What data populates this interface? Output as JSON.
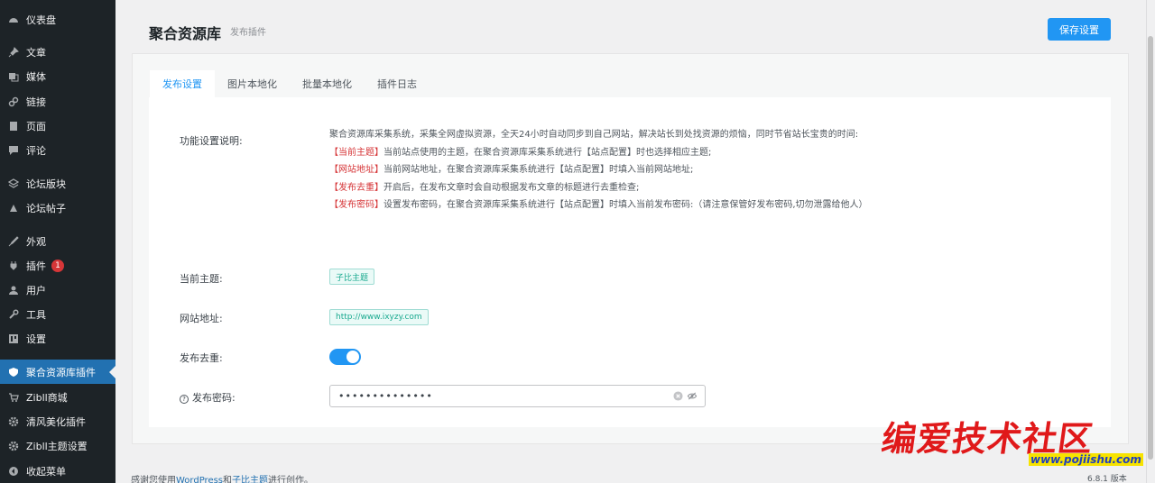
{
  "sidebar": {
    "items": [
      {
        "label": "仪表盘",
        "icon": "dashboard-icon"
      },
      {
        "label": "文章",
        "icon": "pin-icon"
      },
      {
        "label": "媒体",
        "icon": "media-icon"
      },
      {
        "label": "链接",
        "icon": "link-icon"
      },
      {
        "label": "页面",
        "icon": "page-icon"
      },
      {
        "label": "评论",
        "icon": "comment-icon"
      },
      {
        "label": "论坛版块",
        "icon": "forum-icon"
      },
      {
        "label": "论坛帖子",
        "icon": "forum-post-icon"
      },
      {
        "label": "外观",
        "icon": "appearance-icon"
      },
      {
        "label": "插件",
        "icon": "plugin-icon",
        "badge": "1"
      },
      {
        "label": "用户",
        "icon": "user-icon"
      },
      {
        "label": "工具",
        "icon": "wrench-icon"
      },
      {
        "label": "设置",
        "icon": "settings-icon"
      },
      {
        "label": "聚合资源库插件",
        "icon": "shield-icon",
        "active": true
      },
      {
        "label": "Zibll商城",
        "icon": "cart-icon"
      },
      {
        "label": "清风美化插件",
        "icon": "gear-icon"
      },
      {
        "label": "Zibll主题设置",
        "icon": "gear-icon"
      },
      {
        "label": "收起菜单",
        "icon": "collapse-icon"
      }
    ]
  },
  "header": {
    "title": "聚合资源库",
    "subtitle": "发布插件",
    "save_label": "保存设置"
  },
  "tabs": [
    {
      "label": "发布设置",
      "active": true
    },
    {
      "label": "图片本地化"
    },
    {
      "label": "批量本地化"
    },
    {
      "label": "插件日志"
    }
  ],
  "form": {
    "desc_label": "功能设置说明:",
    "desc_intro": "聚合资源库采集系统，采集全网虚拟资源，全天24小时自动同步到自己网站，解决站长到处找资源的烦恼，同时节省站长宝贵的时间:",
    "desc_lines": [
      {
        "tag": "【当前主题】",
        "text": "当前站点使用的主题，在聚合资源库采集系统进行【站点配置】时也选择相应主题;"
      },
      {
        "tag": "【网站地址】",
        "text": "当前网站地址，在聚合资源库采集系统进行【站点配置】时填入当前网站地址;"
      },
      {
        "tag": "【发布去重】",
        "text": "开启后，在发布文章时会自动根据发布文章的标题进行去重检查;"
      },
      {
        "tag": "【发布密码】",
        "text": "设置发布密码，在聚合资源库采集系统进行【站点配置】时填入当前发布密码:（请注意保管好发布密码,切勿泄露给他人）"
      }
    ],
    "theme_label": "当前主题:",
    "theme_value": "子比主题",
    "site_label": "网站地址:",
    "site_value": "http://www.ixyzy.com",
    "dedupe_label": "发布去重:",
    "dedupe_on": true,
    "password_label": "发布密码:",
    "password_value": "••••••••••••••"
  },
  "footer": {
    "prefix": "感谢您使用",
    "wp_link": "WordPress",
    "and": "和",
    "theme_link": "子比主题",
    "suffix": "进行创作。",
    "version": "6.8.1 版本"
  },
  "watermark": {
    "title": "编爱技术社区",
    "url": "www.pojiishu.com"
  },
  "colors": {
    "sidebar_bg": "#1d2327",
    "active_bg": "#2271b1",
    "primary": "#2196f3",
    "tag_red": "#d63638"
  }
}
